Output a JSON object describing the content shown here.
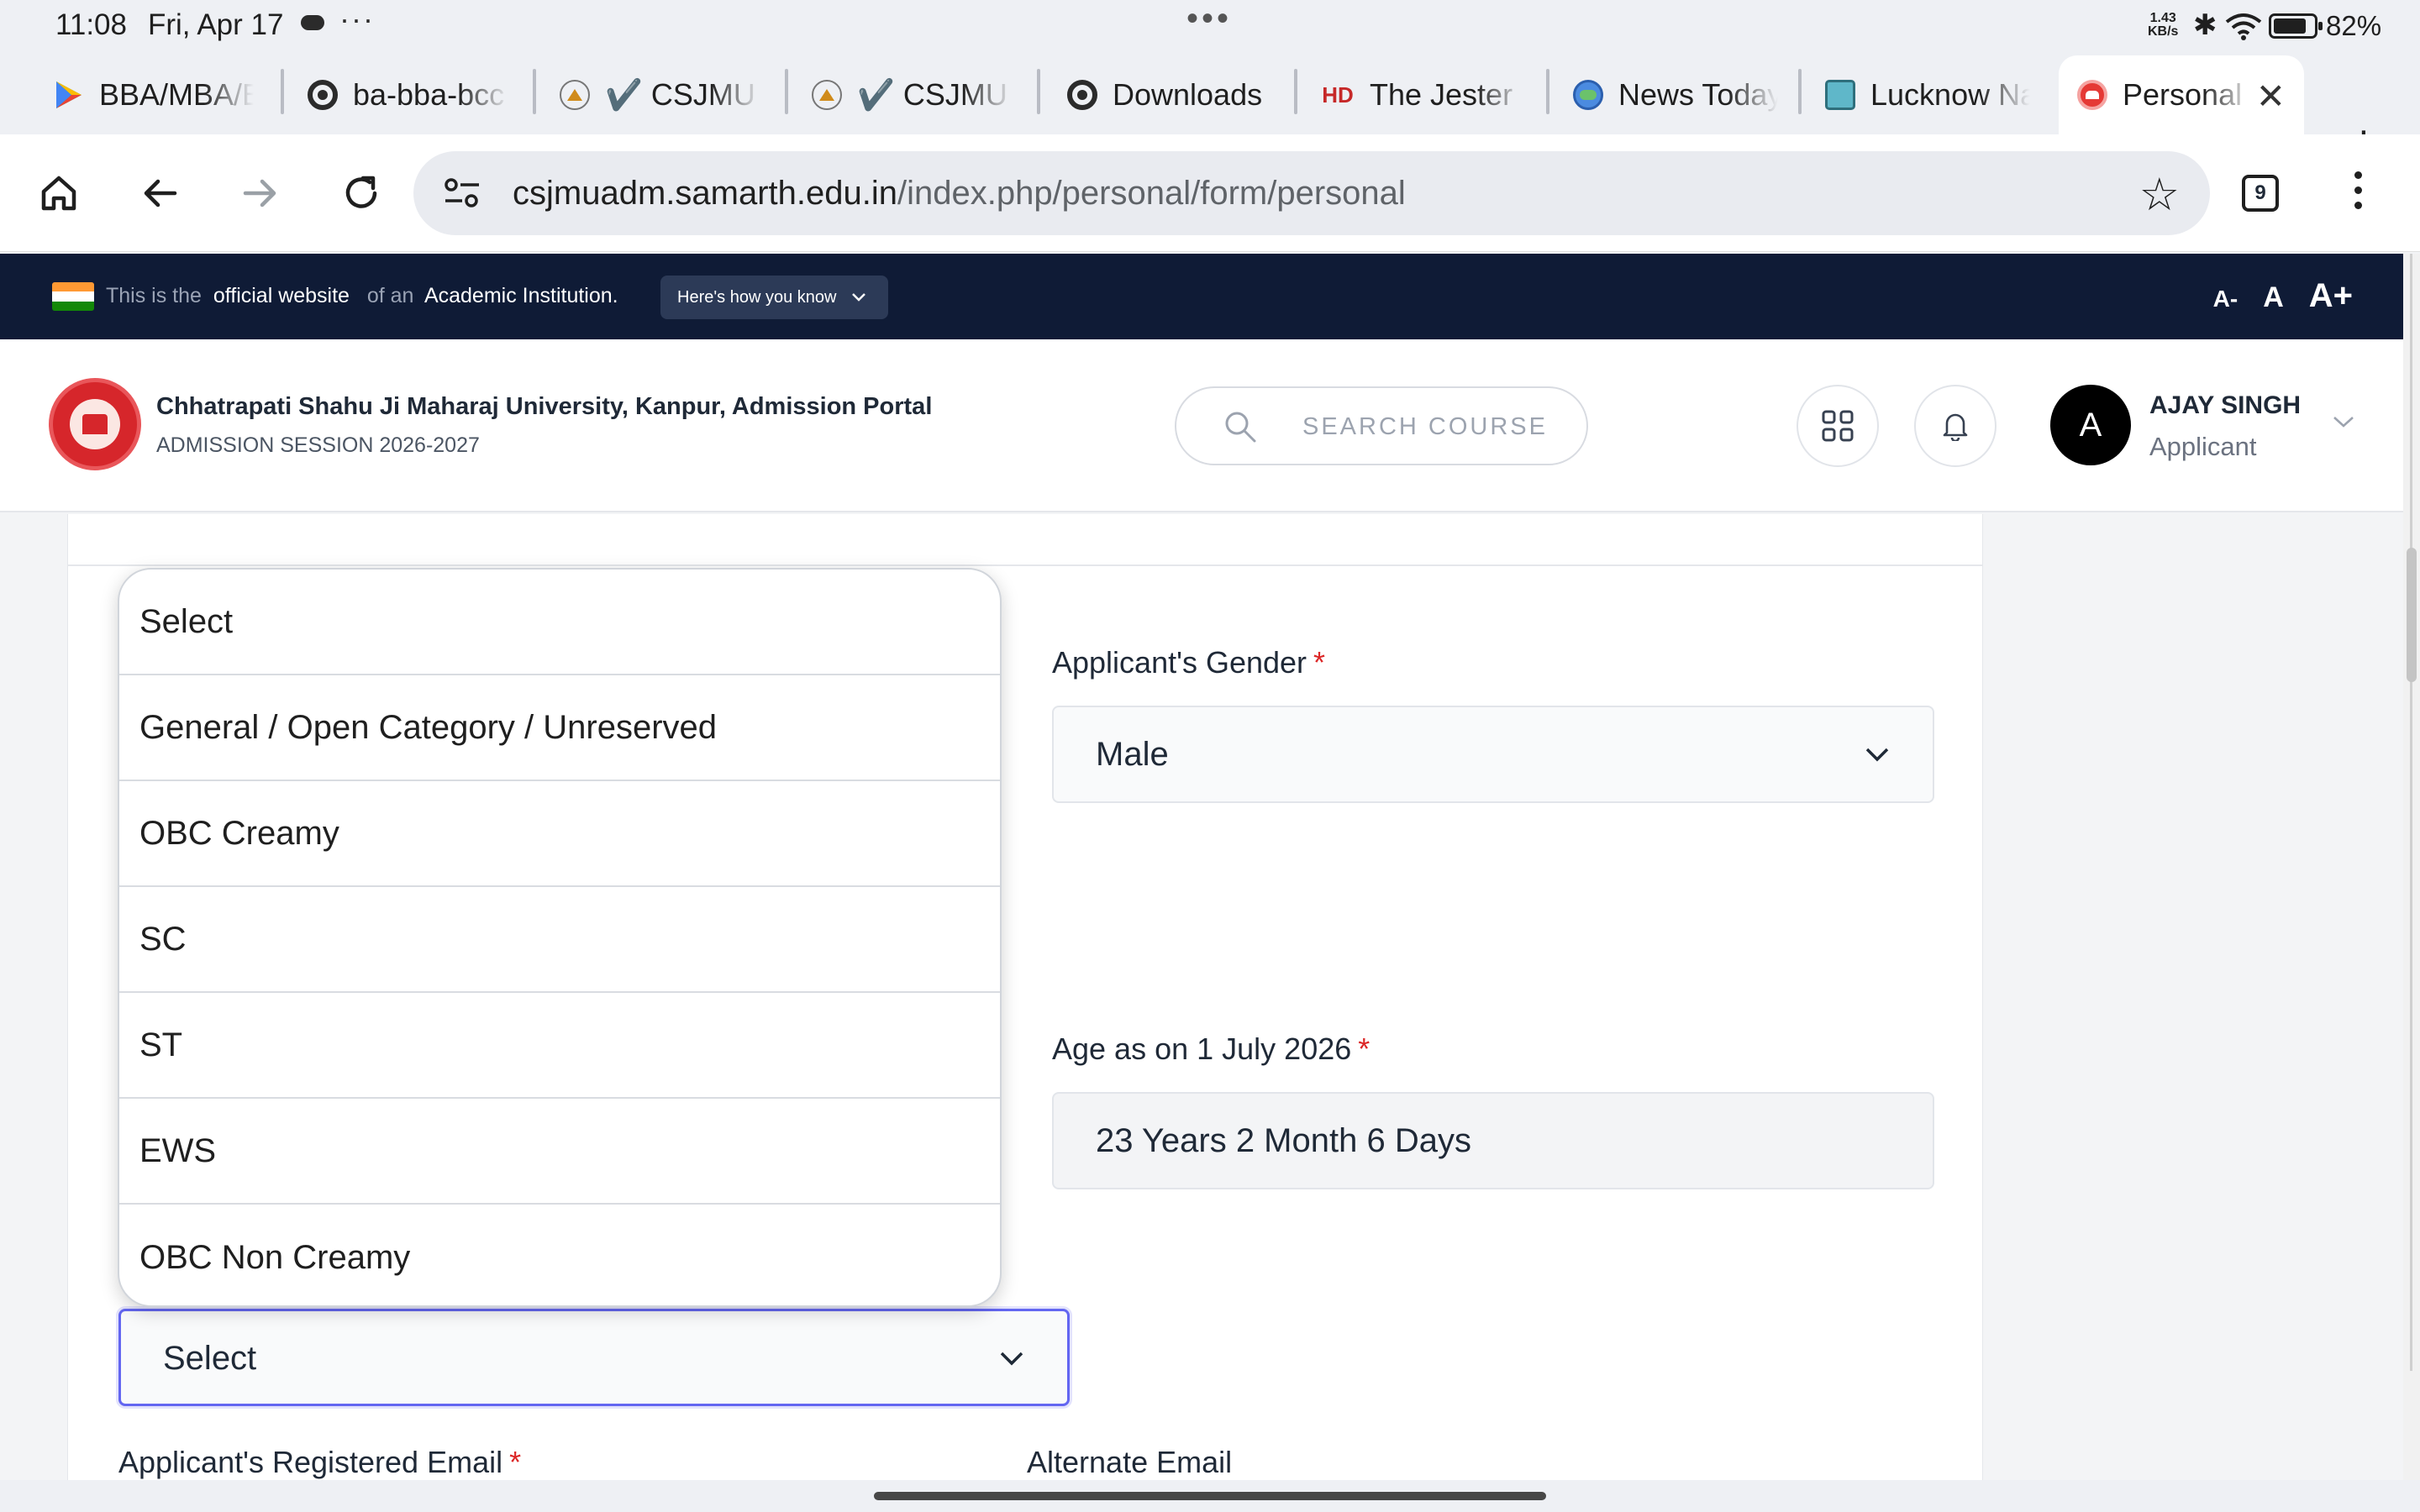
{
  "status_bar": {
    "time": "11:08",
    "date": "Fri, Apr 17",
    "net_speed": "1.43",
    "net_unit": "KB/s",
    "battery": "82%",
    "battery_level": 0.82
  },
  "tabs": [
    {
      "label": "BBA/MBA/B",
      "icon": "play-store-icon"
    },
    {
      "label": "ba-bba-bcc",
      "icon": "chrome-icon"
    },
    {
      "label": "✔️ CSJMU",
      "icon": "csjmu-icon"
    },
    {
      "label": "✔️ CSJMU",
      "icon": "csjmu-icon"
    },
    {
      "label": "Downloads",
      "icon": "chrome-icon"
    },
    {
      "label": "The Jester",
      "icon": "hd-icon"
    },
    {
      "label": "News Today",
      "icon": "globe-icon"
    },
    {
      "label": "Lucknow Na",
      "icon": "image-icon"
    },
    {
      "label": "Personal",
      "icon": "samarth-icon",
      "active": true
    }
  ],
  "toolbar": {
    "url_host": "csjmuadm.samarth.edu.in",
    "url_path": "/index.php/personal/form/personal",
    "tab_count": "9"
  },
  "banner": {
    "text_1": "This is the",
    "text_2": "official website",
    "text_3": "of an",
    "text_4": "Academic Institution.",
    "how_you_know": "Here's how you know",
    "font_small": "A-",
    "font_normal": "A",
    "font_large": "A+"
  },
  "header": {
    "university": "Chhatrapati Shahu Ji Maharaj University, Kanpur, Admission Portal",
    "session": "ADMISSION SESSION 2026-2027",
    "search_placeholder": "SEARCH COURSE",
    "user_initial": "A",
    "user_name": "AJAY SINGH",
    "user_role": "Applicant"
  },
  "form": {
    "gender_label": "Applicant's Gender",
    "gender_value": "Male",
    "age_label": "Age as on 1 July 2026",
    "age_value": "23 Years 2 Month 6 Days",
    "category_value": "Select",
    "email_label": "Applicant's Registered Email",
    "alt_email_label": "Alternate Email",
    "required_mark": "*"
  },
  "category_options": [
    "Select",
    "General / Open Category / Unreserved",
    "OBC Creamy",
    "SC",
    "ST",
    "EWS",
    "OBC Non Creamy"
  ],
  "colors": {
    "banner_bg": "#0f1b36",
    "focus_ring": "#6366f1",
    "required": "#dc2626"
  }
}
